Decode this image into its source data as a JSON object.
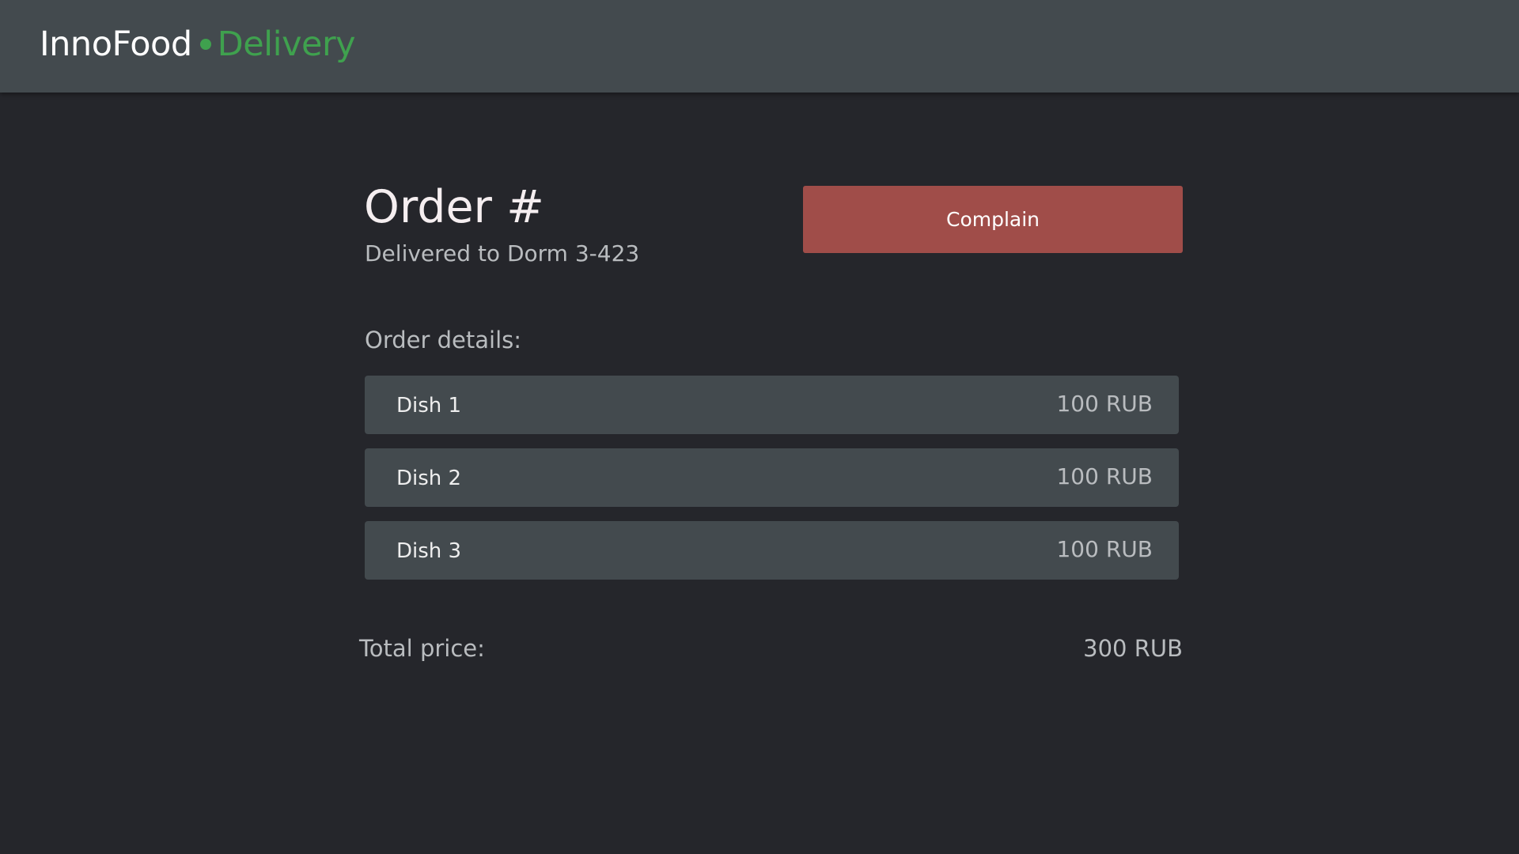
{
  "header": {
    "brand_name": "InnoFood",
    "brand_sub": "Delivery",
    "brand_accent_color": "#3fa14e",
    "background_color": "#434a4e"
  },
  "order": {
    "title": "Order #",
    "subtitle": "Delivered to Dorm 3-423",
    "complain_label": "Complain",
    "complain_color": "#a04d49",
    "details_label": "Order details:",
    "items": [
      {
        "name": "Dish 1",
        "price": "100 RUB"
      },
      {
        "name": "Dish 2",
        "price": "100 RUB"
      },
      {
        "name": "Dish 3",
        "price": "100 RUB"
      }
    ],
    "total_label": "Total price:",
    "total_value": "300 RUB"
  }
}
